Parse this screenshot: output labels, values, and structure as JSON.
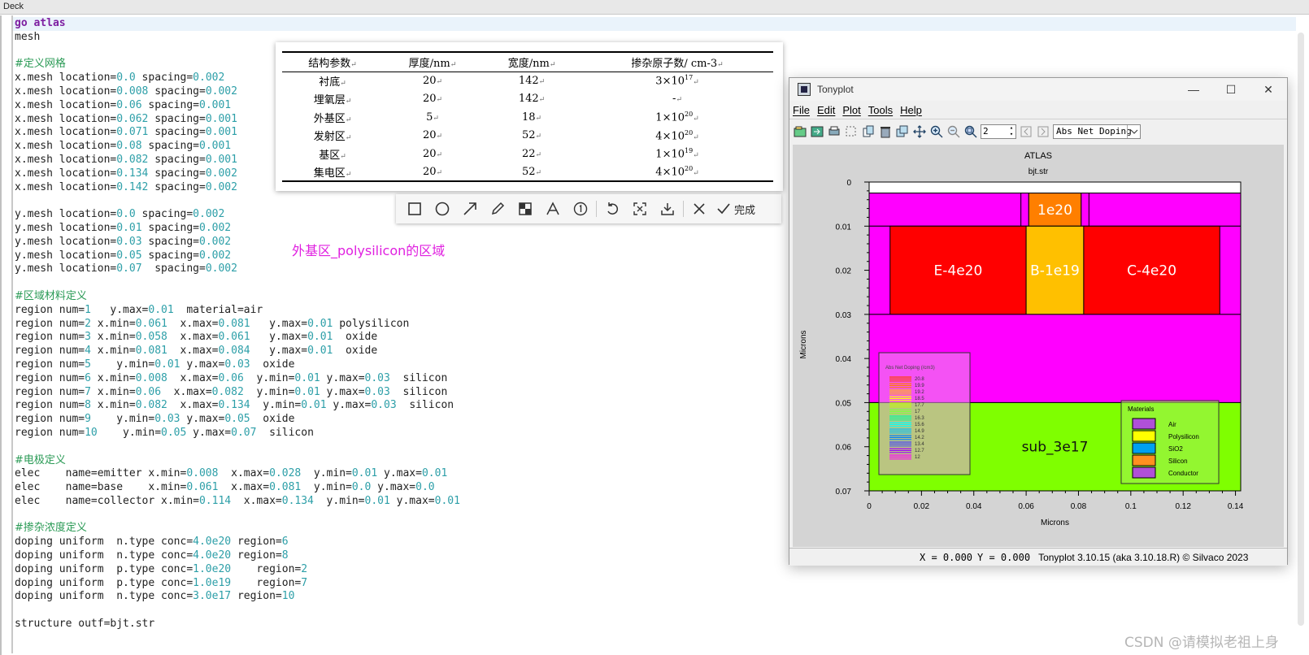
{
  "deck": {
    "title": "Deck",
    "lines": [
      [
        {
          "t": "go atlas",
          "c": "kw"
        }
      ],
      [
        {
          "t": "mesh"
        }
      ],
      [],
      [
        {
          "t": "#定义网格",
          "c": "cmt"
        }
      ],
      [
        {
          "t": "x.mesh location="
        },
        {
          "t": "0.0",
          "c": "num"
        },
        {
          "t": " spacing="
        },
        {
          "t": "0.002",
          "c": "num"
        }
      ],
      [
        {
          "t": "x.mesh location="
        },
        {
          "t": "0.008",
          "c": "num"
        },
        {
          "t": " spacing="
        },
        {
          "t": "0.002",
          "c": "num"
        }
      ],
      [
        {
          "t": "x.mesh location="
        },
        {
          "t": "0.06",
          "c": "num"
        },
        {
          "t": " spacing="
        },
        {
          "t": "0.001",
          "c": "num"
        }
      ],
      [
        {
          "t": "x.mesh location="
        },
        {
          "t": "0.062",
          "c": "num"
        },
        {
          "t": " spacing="
        },
        {
          "t": "0.001",
          "c": "num"
        }
      ],
      [
        {
          "t": "x.mesh location="
        },
        {
          "t": "0.071",
          "c": "num"
        },
        {
          "t": " spacing="
        },
        {
          "t": "0.001",
          "c": "num"
        }
      ],
      [
        {
          "t": "x.mesh location="
        },
        {
          "t": "0.08",
          "c": "num"
        },
        {
          "t": " spacing="
        },
        {
          "t": "0.001",
          "c": "num"
        }
      ],
      [
        {
          "t": "x.mesh location="
        },
        {
          "t": "0.082",
          "c": "num"
        },
        {
          "t": " spacing="
        },
        {
          "t": "0.001",
          "c": "num"
        }
      ],
      [
        {
          "t": "x.mesh location="
        },
        {
          "t": "0.134",
          "c": "num"
        },
        {
          "t": " spacing="
        },
        {
          "t": "0.002",
          "c": "num"
        }
      ],
      [
        {
          "t": "x.mesh location="
        },
        {
          "t": "0.142",
          "c": "num"
        },
        {
          "t": " spacing="
        },
        {
          "t": "0.002",
          "c": "num"
        }
      ],
      [],
      [
        {
          "t": "y.mesh location="
        },
        {
          "t": "0.0",
          "c": "num"
        },
        {
          "t": " spacing="
        },
        {
          "t": "0.002",
          "c": "num"
        }
      ],
      [
        {
          "t": "y.mesh location="
        },
        {
          "t": "0.01",
          "c": "num"
        },
        {
          "t": " spacing="
        },
        {
          "t": "0.002",
          "c": "num"
        }
      ],
      [
        {
          "t": "y.mesh location="
        },
        {
          "t": "0.03",
          "c": "num"
        },
        {
          "t": " spacing="
        },
        {
          "t": "0.002",
          "c": "num"
        }
      ],
      [
        {
          "t": "y.mesh location="
        },
        {
          "t": "0.05",
          "c": "num"
        },
        {
          "t": " spacing="
        },
        {
          "t": "0.002",
          "c": "num"
        }
      ],
      [
        {
          "t": "y.mesh location="
        },
        {
          "t": "0.07",
          "c": "num"
        },
        {
          "t": "  spacing="
        },
        {
          "t": "0.002",
          "c": "num"
        }
      ],
      [],
      [
        {
          "t": "#区域材料定义",
          "c": "cmt"
        }
      ],
      [
        {
          "t": "region num="
        },
        {
          "t": "1",
          "c": "num"
        },
        {
          "t": "   y.max="
        },
        {
          "t": "0.01",
          "c": "num"
        },
        {
          "t": "  material=air"
        }
      ],
      [
        {
          "t": "region num="
        },
        {
          "t": "2",
          "c": "num"
        },
        {
          "t": " x.min="
        },
        {
          "t": "0.061",
          "c": "num"
        },
        {
          "t": "  x.max="
        },
        {
          "t": "0.081",
          "c": "num"
        },
        {
          "t": "   y.max="
        },
        {
          "t": "0.01",
          "c": "num"
        },
        {
          "t": " polysilicon"
        }
      ],
      [
        {
          "t": "region num="
        },
        {
          "t": "3",
          "c": "num"
        },
        {
          "t": " x.min="
        },
        {
          "t": "0.058",
          "c": "num"
        },
        {
          "t": "  x.max="
        },
        {
          "t": "0.061",
          "c": "num"
        },
        {
          "t": "   y.max="
        },
        {
          "t": "0.01",
          "c": "num"
        },
        {
          "t": "  oxide"
        }
      ],
      [
        {
          "t": "region num="
        },
        {
          "t": "4",
          "c": "num"
        },
        {
          "t": " x.min="
        },
        {
          "t": "0.081",
          "c": "num"
        },
        {
          "t": "  x.max="
        },
        {
          "t": "0.084",
          "c": "num"
        },
        {
          "t": "   y.max="
        },
        {
          "t": "0.01",
          "c": "num"
        },
        {
          "t": "  oxide"
        }
      ],
      [
        {
          "t": "region num="
        },
        {
          "t": "5",
          "c": "num"
        },
        {
          "t": "    y.min="
        },
        {
          "t": "0.01",
          "c": "num"
        },
        {
          "t": " y.max="
        },
        {
          "t": "0.03",
          "c": "num"
        },
        {
          "t": "  oxide"
        }
      ],
      [
        {
          "t": "region num="
        },
        {
          "t": "6",
          "c": "num"
        },
        {
          "t": " x.min="
        },
        {
          "t": "0.008",
          "c": "num"
        },
        {
          "t": "  x.max="
        },
        {
          "t": "0.06",
          "c": "num"
        },
        {
          "t": "  y.min="
        },
        {
          "t": "0.01",
          "c": "num"
        },
        {
          "t": " y.max="
        },
        {
          "t": "0.03",
          "c": "num"
        },
        {
          "t": "  silicon"
        }
      ],
      [
        {
          "t": "region num="
        },
        {
          "t": "7",
          "c": "num"
        },
        {
          "t": " x.min="
        },
        {
          "t": "0.06",
          "c": "num"
        },
        {
          "t": "  x.max="
        },
        {
          "t": "0.082",
          "c": "num"
        },
        {
          "t": "  y.min="
        },
        {
          "t": "0.01",
          "c": "num"
        },
        {
          "t": " y.max="
        },
        {
          "t": "0.03",
          "c": "num"
        },
        {
          "t": "  silicon"
        }
      ],
      [
        {
          "t": "region num="
        },
        {
          "t": "8",
          "c": "num"
        },
        {
          "t": " x.min="
        },
        {
          "t": "0.082",
          "c": "num"
        },
        {
          "t": "  x.max="
        },
        {
          "t": "0.134",
          "c": "num"
        },
        {
          "t": "  y.min="
        },
        {
          "t": "0.01",
          "c": "num"
        },
        {
          "t": " y.max="
        },
        {
          "t": "0.03",
          "c": "num"
        },
        {
          "t": "  silicon"
        }
      ],
      [
        {
          "t": "region num="
        },
        {
          "t": "9",
          "c": "num"
        },
        {
          "t": "    y.min="
        },
        {
          "t": "0.03",
          "c": "num"
        },
        {
          "t": " y.max="
        },
        {
          "t": "0.05",
          "c": "num"
        },
        {
          "t": "  oxide"
        }
      ],
      [
        {
          "t": "region num="
        },
        {
          "t": "10",
          "c": "num"
        },
        {
          "t": "    y.min="
        },
        {
          "t": "0.05",
          "c": "num"
        },
        {
          "t": " y.max="
        },
        {
          "t": "0.07",
          "c": "num"
        },
        {
          "t": "  silicon"
        }
      ],
      [],
      [
        {
          "t": "#电极定义",
          "c": "cmt"
        }
      ],
      [
        {
          "t": "elec    name=emitter x.min="
        },
        {
          "t": "0.008",
          "c": "num"
        },
        {
          "t": "  x.max="
        },
        {
          "t": "0.028",
          "c": "num"
        },
        {
          "t": "  y.min="
        },
        {
          "t": "0.01",
          "c": "num"
        },
        {
          "t": " y.max="
        },
        {
          "t": "0.01",
          "c": "num"
        }
      ],
      [
        {
          "t": "elec    name=base    x.min="
        },
        {
          "t": "0.061",
          "c": "num"
        },
        {
          "t": "  x.max="
        },
        {
          "t": "0.081",
          "c": "num"
        },
        {
          "t": "  y.min="
        },
        {
          "t": "0.0",
          "c": "num"
        },
        {
          "t": " y.max="
        },
        {
          "t": "0.0",
          "c": "num"
        }
      ],
      [
        {
          "t": "elec    name=collector x.min="
        },
        {
          "t": "0.114",
          "c": "num"
        },
        {
          "t": "  x.max="
        },
        {
          "t": "0.134",
          "c": "num"
        },
        {
          "t": "  y.min="
        },
        {
          "t": "0.01",
          "c": "num"
        },
        {
          "t": " y.max="
        },
        {
          "t": "0.01",
          "c": "num"
        }
      ],
      [],
      [
        {
          "t": "#掺杂浓度定义",
          "c": "cmt"
        }
      ],
      [
        {
          "t": "doping uniform  n.type conc="
        },
        {
          "t": "4.0e20",
          "c": "num"
        },
        {
          "t": " region="
        },
        {
          "t": "6",
          "c": "num"
        }
      ],
      [
        {
          "t": "doping uniform  n.type conc="
        },
        {
          "t": "4.0e20",
          "c": "num"
        },
        {
          "t": " region="
        },
        {
          "t": "8",
          "c": "num"
        }
      ],
      [
        {
          "t": "doping uniform  p.type conc="
        },
        {
          "t": "1.0e20",
          "c": "num"
        },
        {
          "t": "    region="
        },
        {
          "t": "2",
          "c": "num"
        }
      ],
      [
        {
          "t": "doping uniform  p.type conc="
        },
        {
          "t": "1.0e19",
          "c": "num"
        },
        {
          "t": "    region="
        },
        {
          "t": "7",
          "c": "num"
        }
      ],
      [
        {
          "t": "doping uniform  n.type conc="
        },
        {
          "t": "3.0e17",
          "c": "num"
        },
        {
          "t": " region="
        },
        {
          "t": "10",
          "c": "num"
        }
      ],
      [],
      [
        {
          "t": "structure outf=bjt.str"
        }
      ]
    ]
  },
  "param_table": {
    "headers": [
      "结构参数",
      "厚度/nm",
      "宽度/nm",
      "掺杂原子数/ cm-3"
    ],
    "rows": [
      [
        "衬底",
        "20",
        "142",
        "3×10",
        "17"
      ],
      [
        "埋氧层",
        "20",
        "142",
        "-",
        ""
      ],
      [
        "外基区",
        "5",
        "18",
        "1×10",
        "20"
      ],
      [
        "发射区",
        "20",
        "52",
        "4×10",
        "20"
      ],
      [
        "基区",
        "20",
        "22",
        "1×10",
        "19"
      ],
      [
        "集电区",
        "20",
        "52",
        "4×10",
        "20"
      ]
    ],
    "return_mark": "↵"
  },
  "annotation_toolbar": {
    "done_label": "完成",
    "icons": [
      "rectangle-icon",
      "circle-icon",
      "arrow-icon",
      "pencil-icon",
      "mosaic-icon",
      "text-icon",
      "number-icon",
      "undo-icon",
      "crop-icon",
      "download-icon",
      "close-icon"
    ]
  },
  "overlay_note": "外基区_polysilicon的区域",
  "tonyplot": {
    "window_title": "Tonyplot",
    "menu": [
      "File",
      "Edit",
      "Plot",
      "Tools",
      "Help"
    ],
    "spin_value": "2",
    "quantity_select": "Abs Net Doping",
    "status_x": "X = 0.000",
    "status_y": "Y = 0.000",
    "version": "Tonyplot 3.10.15 (aka 3.10.18.R) © Silvaco 2023"
  },
  "chart_data": {
    "type": "heatmap",
    "title": "ATLAS",
    "subtitle": "bjt.str",
    "xlabel": "Microns",
    "ylabel": "Microns",
    "xlim": [
      0,
      0.142
    ],
    "ylim": [
      0,
      0.07
    ],
    "y_inverted": true,
    "xticks": [
      "0",
      "0.02",
      "0.04",
      "0.06",
      "0.08",
      "0.1",
      "0.12",
      "0.14"
    ],
    "yticks": [
      "0",
      "0.01",
      "0.02",
      "0.03",
      "0.04",
      "0.05",
      "0.06",
      "0.07"
    ],
    "regions": [
      {
        "name": "air",
        "x": [
          0,
          0.142
        ],
        "y": [
          0,
          0.0025
        ],
        "color": "#ffffff"
      },
      {
        "name": "oxide-top",
        "x": [
          0,
          0.142
        ],
        "y": [
          0.0025,
          0.01
        ],
        "color": "#ff00ff"
      },
      {
        "name": "spacer-left",
        "x": [
          0.058,
          0.061
        ],
        "y": [
          0.0025,
          0.01
        ],
        "color": "#ff00ff"
      },
      {
        "name": "spacer-right",
        "x": [
          0.081,
          0.084
        ],
        "y": [
          0.0025,
          0.01
        ],
        "color": "#ff00ff"
      },
      {
        "name": "extrinsic-base",
        "x": [
          0.061,
          0.081
        ],
        "y": [
          0.0025,
          0.01
        ],
        "color": "#ff7f00",
        "label": "1e20"
      },
      {
        "name": "oxide-mid",
        "x": [
          0,
          0.142
        ],
        "y": [
          0.01,
          0.03
        ],
        "color": "#ff00ff"
      },
      {
        "name": "emitter",
        "x": [
          0.008,
          0.06
        ],
        "y": [
          0.01,
          0.03
        ],
        "color": "#ff0000",
        "label": "E-4e20"
      },
      {
        "name": "base",
        "x": [
          0.06,
          0.082
        ],
        "y": [
          0.01,
          0.03
        ],
        "color": "#ffc000",
        "label": "B-1e19"
      },
      {
        "name": "collector",
        "x": [
          0.082,
          0.134
        ],
        "y": [
          0.01,
          0.03
        ],
        "color": "#ff0000",
        "label": "C-4e20"
      },
      {
        "name": "buried-oxide",
        "x": [
          0,
          0.142
        ],
        "y": [
          0.03,
          0.05
        ],
        "color": "#ff00ff"
      },
      {
        "name": "substrate",
        "x": [
          0,
          0.142
        ],
        "y": [
          0.05,
          0.07
        ],
        "color": "#7fff00",
        "label": "sub_3e17"
      }
    ],
    "doping_legend": {
      "title": "Abs Net Doping (/cm3)",
      "values": [
        "20.8",
        "19.9",
        "19.2",
        "18.5",
        "17.7",
        "17",
        "16.3",
        "15.6",
        "14.9",
        "14.2",
        "13.4",
        "12.7",
        "12"
      ],
      "colors": [
        "#ff4000",
        "#ff8000",
        "#ffc000",
        "#ffff00",
        "#c0ff00",
        "#80ff40",
        "#00ffa0",
        "#00ffff",
        "#00c0ff",
        "#0080ff",
        "#4040ff",
        "#a000ff",
        "#ff00ff"
      ]
    },
    "materials_legend": {
      "title": "Materials",
      "items": [
        {
          "label": "Air",
          "color": "#b050d8"
        },
        {
          "label": "Polysilicon",
          "color": "#ffff00"
        },
        {
          "label": "SiO2",
          "color": "#00a0f0"
        },
        {
          "label": "Silicon",
          "color": "#ff9020"
        },
        {
          "label": "Conductor",
          "color": "#b050d8"
        }
      ]
    }
  },
  "watermark": "CSDN @请模拟老祖上身"
}
